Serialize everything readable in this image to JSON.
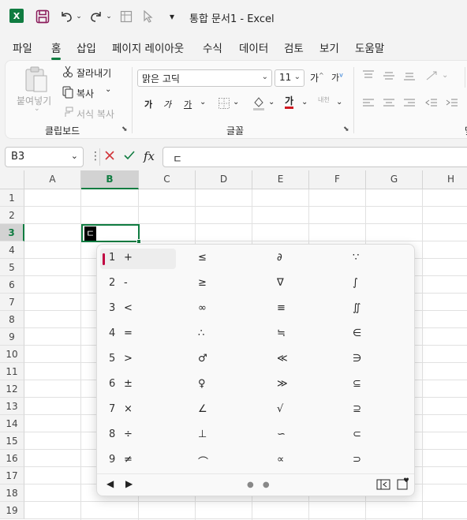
{
  "titlebar": {
    "app_icon": "excel-logo",
    "app_letter": "X",
    "save_icon": "save-icon",
    "undo_icon": "undo-icon",
    "redo_icon": "redo-icon",
    "qat_dropdown": "▾",
    "title": "통합 문서1  -  Excel"
  },
  "menu": {
    "tabs": [
      "파일",
      "홈",
      "삽입",
      "페이지 레이아웃",
      "수식",
      "데이터",
      "검토",
      "보기",
      "도움말"
    ],
    "active_index": 1
  },
  "ribbon": {
    "clipboard": {
      "paste": "붙여넣기",
      "cut": "잘라내기",
      "copy": "복사",
      "format_painter": "서식 복사",
      "group_label": "클립보드"
    },
    "font": {
      "font_name": "맑은 고딕",
      "font_size": "11",
      "grow": "가",
      "shrink": "가",
      "bold": "가",
      "italic": "가",
      "underline": "가",
      "font_color": "가",
      "phonetic": "내천",
      "group_label": "글꼴"
    },
    "alignment_label_partial": "맞"
  },
  "formula_bar": {
    "name_box": "B3",
    "fx": "fx",
    "content": "ㄷ"
  },
  "sheet": {
    "columns": [
      "A",
      "B",
      "C",
      "D",
      "E",
      "F",
      "G",
      "H"
    ],
    "rows": [
      "1",
      "2",
      "3",
      "4",
      "5",
      "6",
      "7",
      "8",
      "9",
      "10",
      "11",
      "12",
      "13",
      "14",
      "15",
      "16",
      "17",
      "18",
      "19"
    ],
    "active_column": "B",
    "active_row": "3",
    "active_cell_text": "ㄷ"
  },
  "ime_popup": {
    "columns": [
      [
        {
          "n": "1",
          "s": "+"
        },
        {
          "n": "2",
          "s": "-"
        },
        {
          "n": "3",
          "s": "<"
        },
        {
          "n": "4",
          "s": "="
        },
        {
          "n": "5",
          "s": ">"
        },
        {
          "n": "6",
          "s": "±"
        },
        {
          "n": "7",
          "s": "×"
        },
        {
          "n": "8",
          "s": "÷"
        },
        {
          "n": "9",
          "s": "≠"
        }
      ],
      [
        "≤",
        "≥",
        "∞",
        "∴",
        "♂",
        "♀",
        "∠",
        "⊥",
        "⌒"
      ],
      [
        "∂",
        "∇",
        "≡",
        "≒",
        "≪",
        "≫",
        "√",
        "∽",
        "∝"
      ],
      [
        "∵",
        "∫",
        "∬",
        "∈",
        "∋",
        "⊆",
        "⊇",
        "⊂",
        "⊃"
      ]
    ],
    "footer": {
      "prev": "◀",
      "next": "▶",
      "dots": "● ●",
      "emoji_panel_icon": "emoji-panel-icon",
      "favorites_icon": "favorites-icon"
    }
  }
}
